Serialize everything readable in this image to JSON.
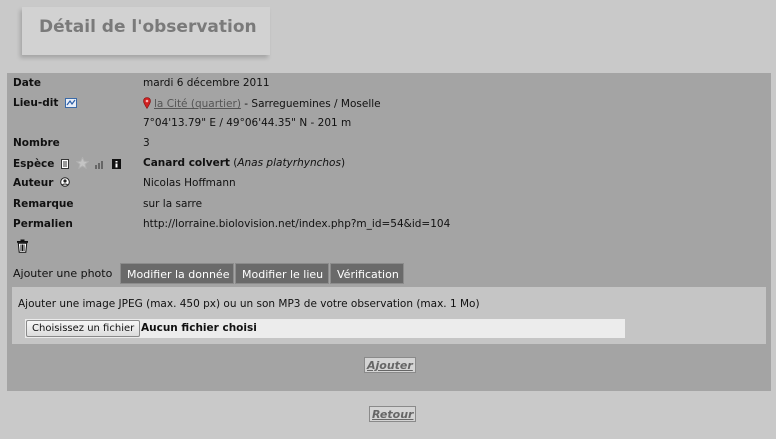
{
  "page": {
    "title": "Détail de l'observation"
  },
  "details": {
    "date": {
      "label": "Date",
      "value": "mardi 6 décembre 2011"
    },
    "lieu_dit": {
      "label": "Lieu-dit",
      "place_link": "la Cité (quartier)",
      "place_rest": " - Sarreguemines / Moselle",
      "coords": "7°04'13.79\" E / 49°06'44.35\" N - 201 m"
    },
    "nombre": {
      "label": "Nombre",
      "value": "3"
    },
    "espece": {
      "label": "Espèce",
      "common": "Canard colvert",
      "latin": "Anas platyrhynchos",
      "open": " (",
      "close": ")"
    },
    "auteur": {
      "label": "Auteur",
      "value": "Nicolas Hoffmann"
    },
    "remarque": {
      "label": "Remarque",
      "value": "sur la sarre"
    },
    "permalien": {
      "label": "Permalien",
      "value": "http://lorraine.biolovision.net/index.php?m_id=54&id=104"
    }
  },
  "tabs": [
    {
      "label": "Ajouter une photo",
      "active": true
    },
    {
      "label": "Modifier la donnée",
      "active": false
    },
    {
      "label": "Modifier le lieu",
      "active": false
    },
    {
      "label": "Vérification",
      "active": false
    }
  ],
  "upload": {
    "instructions": "Ajouter une image JPEG (max. 450 px) ou un son MP3 de votre observation (max. 1 Mo)",
    "file_button": "Choisissez un fichier",
    "file_status": "Aucun fichier choisi",
    "submit": "Ajouter"
  },
  "back_button": "Retour",
  "colors": {
    "background": "#c9c9c9",
    "panel": "#a4a4a4",
    "tab_inactive": "#6a6a6a",
    "title": "#7a7a7a"
  }
}
